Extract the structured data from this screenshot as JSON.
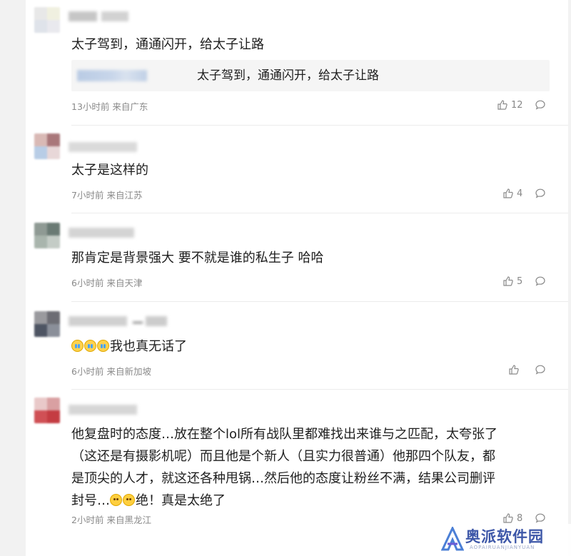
{
  "comments": [
    {
      "text": "太子驾到，通通闪开，给太子让路",
      "quote": "太子驾到，通通闪开，给太子让路",
      "time": "13小时前",
      "location": "来自广东",
      "likes": "12"
    },
    {
      "text": "太子是这样的",
      "time": "7小时前",
      "location": "来自江苏",
      "likes": "4"
    },
    {
      "text": "那肯定是背景强大 要不就是谁的私生子 哈哈",
      "time": "6小时前",
      "location": "来自天津",
      "likes": "5"
    },
    {
      "text": "我也真无话了",
      "time": "6小时前",
      "location": "来自新加坡",
      "likes": ""
    },
    {
      "text_line1": "他复盘时的态度…放在整个lol所有战队里都难找出来谁与之匹配，太夸张了",
      "text_line2": "（这还是有摄影机呢）而且他是个新人（且实力很普通）他那四个队友，都",
      "text_line3": "是顶尖的人才，就这还各种甩锅…然后他的态度让粉丝不满，结果公司删评",
      "text_line4_a": "封号…",
      "text_line4_b": "绝！真是太绝了",
      "time": "2小时前",
      "location": "来自黑龙江",
      "likes": "8"
    }
  ],
  "watermark": {
    "name": "奥派软件园",
    "sub": "AOPAIRUANJIANYUAN"
  },
  "colors": {
    "text": "#1e1e1e",
    "meta": "#8a8a8a",
    "quote_bg": "#f5f5f5",
    "page_bg": "#f2f2f2"
  }
}
